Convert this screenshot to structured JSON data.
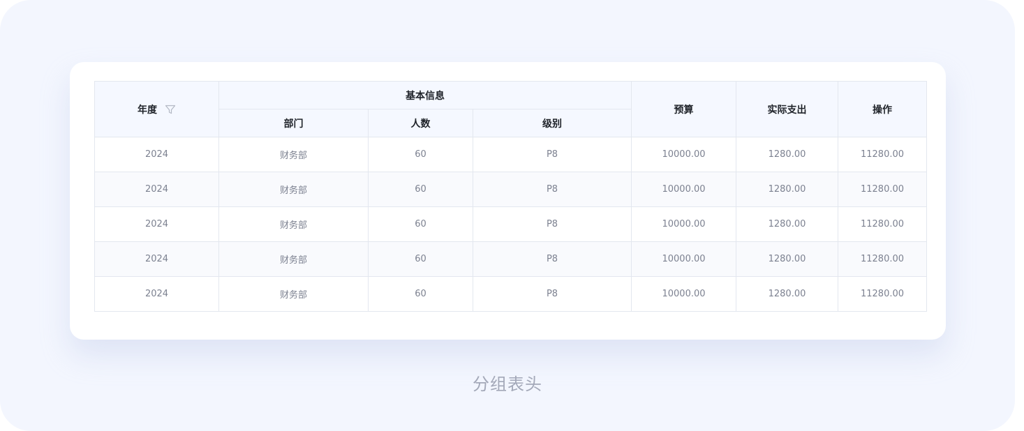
{
  "table": {
    "headers": {
      "year": "年度",
      "basic_info": "基本信息",
      "department": "部门",
      "headcount": "人数",
      "level": "级别",
      "budget": "预算",
      "actual_expense": "实际支出",
      "action": "操作"
    },
    "rows": [
      [
        "2024",
        "财务部",
        "60",
        "P8",
        "10000.00",
        "1280.00",
        "11280.00"
      ],
      [
        "2024",
        "财务部",
        "60",
        "P8",
        "10000.00",
        "1280.00",
        "11280.00"
      ],
      [
        "2024",
        "财务部",
        "60",
        "P8",
        "10000.00",
        "1280.00",
        "11280.00"
      ],
      [
        "2024",
        "财务部",
        "60",
        "P8",
        "10000.00",
        "1280.00",
        "11280.00"
      ],
      [
        "2024",
        "财务部",
        "60",
        "P8",
        "10000.00",
        "1280.00",
        "11280.00"
      ]
    ]
  },
  "caption": "分组表头",
  "icons": {
    "filter": "filter-icon"
  },
  "colors": {
    "background": "#f3f6fe",
    "header_bg": "#f5f8ff",
    "border": "#e3e7ef",
    "header_text": "#1f2329",
    "cell_text": "#7c8190",
    "caption_text": "#a3a8b8"
  }
}
